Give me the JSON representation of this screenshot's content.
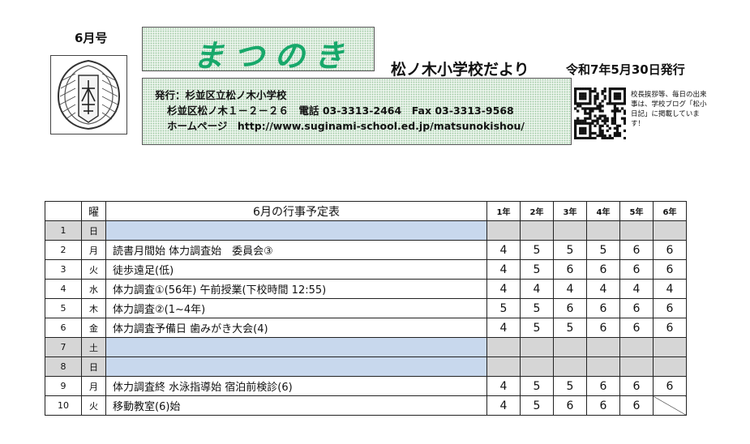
{
  "header": {
    "issue": "6月号",
    "newsletter_title": "まつのき",
    "school_newsletter": "松ノ木小学校だより",
    "date": "令和7年5月30日発行",
    "publisher": "発行：杉並区立松ノ木小学校",
    "address_line": "杉並区松ノ木１－２－２６　電話 03-3313-2464　Fax 03-3313-9568",
    "homepage_line": "ホームページ　http://www.suginami-school.ed.jp/matsunokishou/",
    "qr_caption": "校長挨拶等、毎日の出来事は、学校ブログ「松小日記」に掲載しています！"
  },
  "schedule": {
    "col_day": "",
    "col_dow": "曜",
    "title": "6月の行事予定表",
    "grades": [
      "1年",
      "2年",
      "3年",
      "4年",
      "5年",
      "6年"
    ],
    "rows": [
      {
        "day": "1",
        "dow": "日",
        "event": "",
        "periods": [
          "",
          "",
          "",
          "",
          "",
          ""
        ],
        "weekend": true
      },
      {
        "day": "2",
        "dow": "月",
        "event": "読書月間始 体力調査始　委員会③",
        "periods": [
          "4",
          "5",
          "5",
          "5",
          "6",
          "6"
        ]
      },
      {
        "day": "3",
        "dow": "火",
        "event": "徒歩遠足(低)",
        "periods": [
          "4",
          "5",
          "6",
          "6",
          "6",
          "6"
        ]
      },
      {
        "day": "4",
        "dow": "水",
        "event": "体力調査①(56年) 午前授業(下校時間 12:55)",
        "periods": [
          "4",
          "4",
          "4",
          "4",
          "4",
          "4"
        ]
      },
      {
        "day": "5",
        "dow": "木",
        "event": "体力調査②(1~4年)",
        "periods": [
          "5",
          "5",
          "6",
          "6",
          "6",
          "6"
        ]
      },
      {
        "day": "6",
        "dow": "金",
        "event": "体力調査予備日 歯みがき大会(4)",
        "periods": [
          "4",
          "5",
          "5",
          "6",
          "6",
          "6"
        ]
      },
      {
        "day": "7",
        "dow": "土",
        "event": "",
        "periods": [
          "",
          "",
          "",
          "",
          "",
          ""
        ],
        "weekend": true
      },
      {
        "day": "8",
        "dow": "日",
        "event": "",
        "periods": [
          "",
          "",
          "",
          "",
          "",
          ""
        ],
        "weekend": true
      },
      {
        "day": "9",
        "dow": "月",
        "event": "体力調査終 水泳指導始 宿泊前検診(6)",
        "periods": [
          "4",
          "5",
          "5",
          "6",
          "6",
          "6"
        ]
      },
      {
        "day": "10",
        "dow": "火",
        "event": "移動教室(6)始",
        "periods": [
          "4",
          "5",
          "6",
          "6",
          "6",
          ""
        ],
        "slash_last": true
      }
    ]
  },
  "colors": {
    "title_green": "#17a86a",
    "weekend_blue": "#c8d8ed",
    "weekend_gray": "#d6d6d6"
  },
  "icons": {
    "emblem": "school-emblem-icon",
    "qr": "qr-code-icon"
  }
}
